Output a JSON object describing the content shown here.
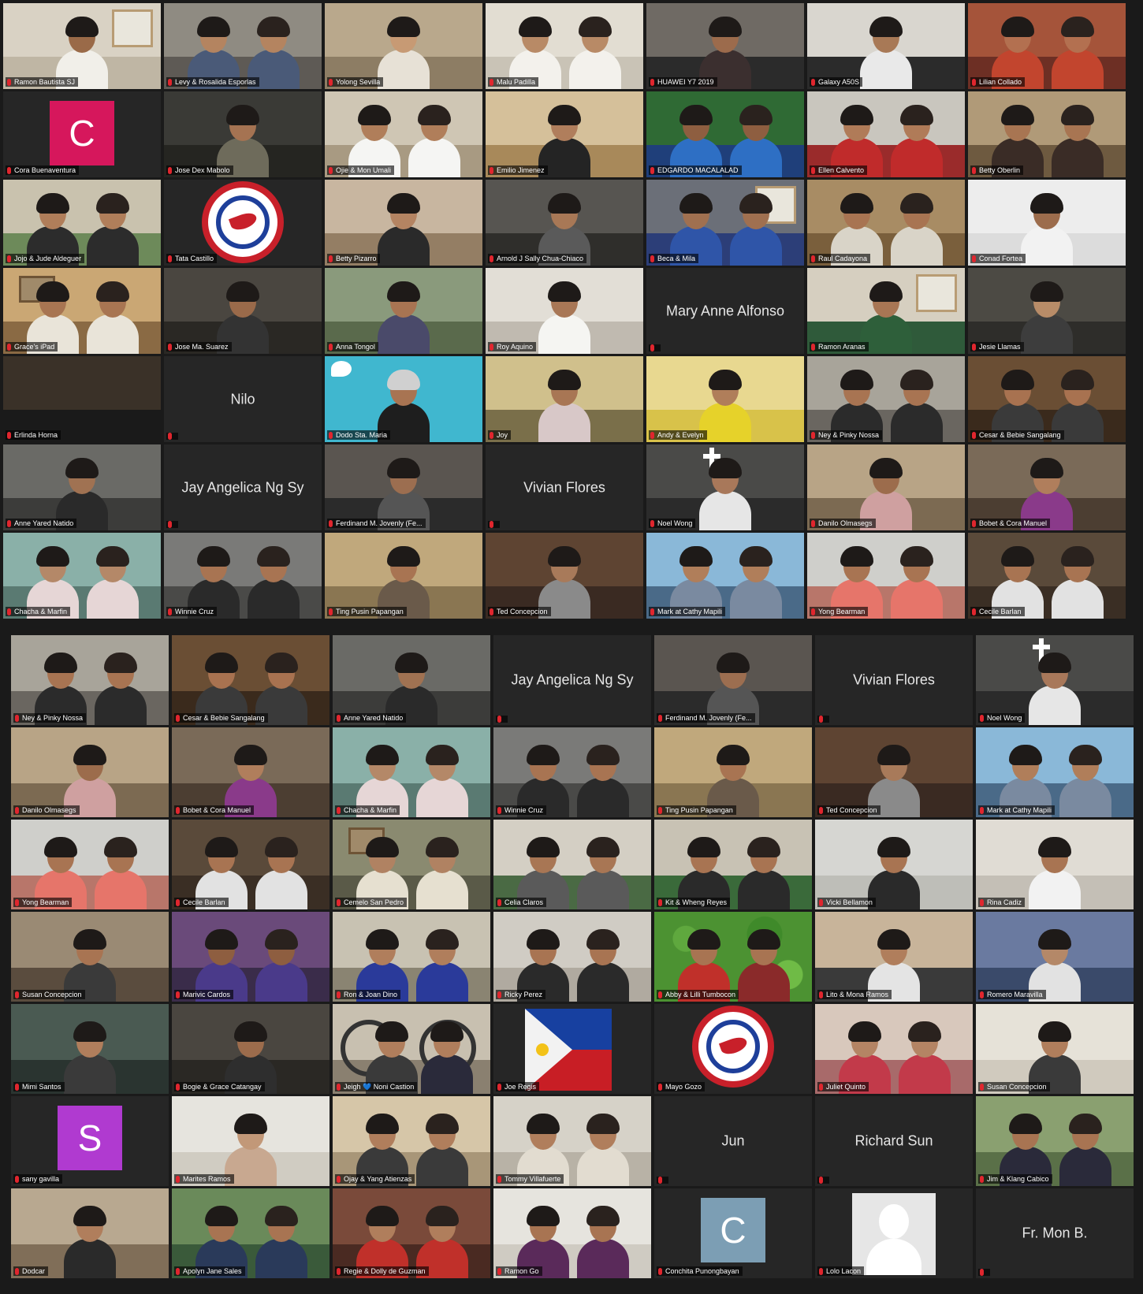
{
  "colors": {
    "background": "#1a1a1a",
    "tile": "#262626",
    "active_speaker_border": "#c8d36a",
    "muted_mic": "#e0262e",
    "avatar_pink": "#d6175c",
    "avatar_purple": "#b03ad0",
    "avatar_steel": "#7c9eb4"
  },
  "top_gallery": {
    "participants": [
      {
        "name": "Ramon Bautista SJ",
        "kind": "video",
        "people": 1,
        "wall": "#d9d2c4",
        "floor": "#bfb6a4",
        "skin": "#9a6a48",
        "shirt": "#f1efe9",
        "scene": "window"
      },
      {
        "name": "Levy & Rosalida Esporlas",
        "kind": "video",
        "people": 2,
        "wall": "#8f8b82",
        "floor": "#5e5a55",
        "skin": "#b48460",
        "shirt": "#4a5a78"
      },
      {
        "name": "Yolong Sevilla",
        "kind": "video",
        "people": 1,
        "wall": "#b9a88c",
        "floor": "#8d7d64",
        "skin": "#c79a74",
        "shirt": "#e7e1d6"
      },
      {
        "name": "Malu Padilla",
        "kind": "video",
        "people": 2,
        "wall": "#e2ddd2",
        "floor": "#c9c3b6",
        "skin": "#b88a66",
        "shirt": "#f3f1ec"
      },
      {
        "name": "HUAWEI Y7 2019",
        "kind": "video",
        "people": 1,
        "wall": "#6f6a64",
        "floor": "#2b2b2b",
        "skin": "#9c6b4c",
        "shirt": "#3b2f2f"
      },
      {
        "name": "Galaxy A50S",
        "kind": "video",
        "people": 1,
        "wall": "#d9d6cf",
        "floor": "#2b2b2b",
        "skin": "#a87956",
        "shirt": "#e9e9e9"
      },
      {
        "name": "Lilian Collado",
        "kind": "video",
        "people": 2,
        "wall": "#a5543a",
        "floor": "#6d2f24",
        "skin": "#b37050",
        "shirt": "#c2452e"
      },
      {
        "name": "Cora Buenaventura",
        "kind": "avatar",
        "letter": "C",
        "color": "#d6175c"
      },
      {
        "name": "Jose Dex Mabolo",
        "kind": "video",
        "people": 1,
        "wall": "#3a3a36",
        "floor": "#252521",
        "skin": "#a57352",
        "shirt": "#6e6b5b"
      },
      {
        "name": "Ojie & Mon Umali",
        "kind": "video",
        "people": 2,
        "wall": "#cfc6b4",
        "floor": "#a89a82",
        "skin": "#b07e5a",
        "shirt": "#f5f5f3"
      },
      {
        "name": "Emilio Jimenez",
        "kind": "video",
        "people": 1,
        "wall": "#d5c09a",
        "floor": "#a8895a",
        "skin": "#b07e5c",
        "shirt": "#242424"
      },
      {
        "name": "EDGARDO MACALALAD",
        "kind": "video",
        "people": 2,
        "wall": "#2f6a34",
        "floor": "#1f3f7a",
        "skin": "#8e5e40",
        "shirt": "#2e6fc4"
      },
      {
        "name": "Ellen Calvento",
        "kind": "video",
        "people": 2,
        "wall": "#c9c6be",
        "floor": "#9a2b2b",
        "skin": "#b07b58",
        "shirt": "#c02b2b"
      },
      {
        "name": "Betty Oberlin",
        "kind": "video",
        "people": 2,
        "wall": "#b09a78",
        "floor": "#6e5a40",
        "skin": "#a87552",
        "shirt": "#3a2c26"
      },
      {
        "name": "Jojo & Jude Aldeguer",
        "kind": "video",
        "people": 2,
        "wall": "#c9c2ae",
        "floor": "#6d8a5a",
        "skin": "#b07e5a",
        "shirt": "#2c2c2c"
      },
      {
        "name": "Tata Castillo",
        "kind": "logo"
      },
      {
        "name": "Betty Pizarro",
        "kind": "video",
        "people": 1,
        "wall": "#c8b6a0",
        "floor": "#947e64",
        "skin": "#b48462",
        "shirt": "#2a2a2a"
      },
      {
        "name": "Arnold J Sally Chua-Chiaco",
        "kind": "video",
        "people": 1,
        "wall": "#575551",
        "floor": "#2f2e2b",
        "skin": "#a87856",
        "shirt": "#5a5a5a"
      },
      {
        "name": "Beca & Mila",
        "kind": "video",
        "people": 2,
        "wall": "#6b6f78",
        "floor": "#2c3e78",
        "skin": "#a07050",
        "shirt": "#2f55a8",
        "scene": "window"
      },
      {
        "name": "Raul Cadayona",
        "kind": "video",
        "people": 2,
        "wall": "#a88c64",
        "floor": "#7a5f3c",
        "skin": "#a87452",
        "shirt": "#d9d4c8"
      },
      {
        "name": "Conad Fortea",
        "kind": "video",
        "people": 1,
        "wall": "#ededed",
        "floor": "#dcdcdc",
        "skin": "#9c6c4c",
        "shirt": "#f2f2f2"
      },
      {
        "name": "Grace's iPad",
        "kind": "video",
        "people": 2,
        "wall": "#caa774",
        "floor": "#8a6a44",
        "skin": "#a87552",
        "shirt": "#e9e4d9",
        "scene": "frame"
      },
      {
        "name": "Jose Ma. Suarez",
        "kind": "video",
        "people": 1,
        "wall": "#4a4640",
        "floor": "#2a2824",
        "skin": "#9a6a4a",
        "shirt": "#333"
      },
      {
        "name": "Anna Tongol",
        "kind": "video",
        "people": 1,
        "wall": "#8a9a7c",
        "floor": "#5a6a4c",
        "skin": "#a87452",
        "shirt": "#4a4a6a"
      },
      {
        "name": "Roy Aquino",
        "kind": "video",
        "people": 1,
        "wall": "#e2ded6",
        "floor": "#c0bab0",
        "skin": "#a87756",
        "shirt": "#f5f5f2"
      },
      {
        "name": "Mary Anne Alfonso",
        "kind": "name"
      },
      {
        "name": "Ramon Aranas",
        "kind": "video",
        "people": 1,
        "wall": "#d6cfc0",
        "floor": "#2f5a3a",
        "skin": "#a87654",
        "shirt": "#2e5f3a",
        "scene": "window"
      },
      {
        "name": "Jesie Llamas",
        "kind": "video",
        "people": 1,
        "wall": "#4c4a44",
        "floor": "#2e2d2a",
        "skin": "#b88c68",
        "shirt": "#3d3d3d"
      },
      {
        "name": "Erlinda Horna",
        "kind": "video",
        "people": 0,
        "wall": "#3a3128",
        "floor": "#1a1a1a"
      },
      {
        "name": "Nilo",
        "kind": "name"
      },
      {
        "name": "Dodo Sta. Maria",
        "kind": "twitter"
      },
      {
        "name": "Joy",
        "kind": "video",
        "people": 1,
        "wall": "#d0c08c",
        "floor": "#7a6f4a",
        "skin": "#a87654",
        "shirt": "#d8c8c8"
      },
      {
        "name": "Andy & Evelyn",
        "kind": "video",
        "people": 1,
        "wall": "#e8d890",
        "floor": "#d8c24a",
        "skin": "#b07e5a",
        "shirt": "#e6d22a"
      },
      {
        "name": "Ney & Pinky Nossa",
        "kind": "video",
        "people": 2,
        "wall": "#a8a49a",
        "floor": "#6a6660",
        "skin": "#a87452",
        "shirt": "#2b2b2b"
      },
      {
        "name": "Cesar & Bebie Sangalang",
        "kind": "video",
        "people": 2,
        "wall": "#6a4e34",
        "floor": "#3a2a1c",
        "skin": "#a87250",
        "shirt": "#3a3a3a"
      },
      {
        "name": "Anne Yared Natido",
        "kind": "video",
        "people": 1,
        "wall": "#6a6a66",
        "floor": "#3c3c3a",
        "skin": "#a07252",
        "shirt": "#2a2a2a"
      },
      {
        "name": "Jay Angelica Ng Sy",
        "kind": "name"
      },
      {
        "name": "Ferdinand M. Jovenly (Fe...",
        "kind": "video",
        "people": 1,
        "wall": "#5a5550",
        "floor": "#2b2b2b",
        "skin": "#9c6e50",
        "shirt": "#555"
      },
      {
        "name": "Vivian Flores",
        "kind": "name"
      },
      {
        "name": "Noel Wong",
        "kind": "video",
        "people": 1,
        "wall": "#4a4a48",
        "floor": "#2b2b2b",
        "skin": "#a8785a",
        "shirt": "#e6e6e6",
        "scene": "cross"
      },
      {
        "name": "Danilo Olmasegs",
        "kind": "video",
        "people": 1,
        "wall": "#b8a486",
        "floor": "#7c6a52",
        "skin": "#9c6c4c",
        "shirt": "#cfa0a0"
      },
      {
        "name": "Bobet & Cora Manuel",
        "kind": "video",
        "people": 1,
        "wall": "#7a6a58",
        "floor": "#4c3e32",
        "skin": "#b07e5c",
        "shirt": "#8a3a8a"
      },
      {
        "name": "Chacha & Marfin",
        "kind": "video",
        "people": 2,
        "wall": "#8ab0a8",
        "floor": "#5a7a72",
        "skin": "#b48868",
        "shirt": "#e6d6d6"
      },
      {
        "name": "Winnie Cruz",
        "kind": "video",
        "people": 2,
        "wall": "#7a7a78",
        "floor": "#4a4a48",
        "skin": "#a87452",
        "shirt": "#2a2a2a"
      },
      {
        "name": "Ting Pusin Papangan",
        "kind": "video",
        "people": 1,
        "wall": "#c0a87c",
        "floor": "#8a7652",
        "skin": "#a87452",
        "shirt": "#6a5a4a"
      },
      {
        "name": "Ted Concepcion",
        "kind": "video",
        "people": 1,
        "wall": "#5e4432",
        "floor": "#3a2a22",
        "skin": "#a87a5a",
        "shirt": "#8a8a8a"
      },
      {
        "name": "Mark at Cathy Mapili",
        "kind": "video",
        "people": 2,
        "wall": "#8ab8d8",
        "floor": "#4a6a88",
        "skin": "#b07e5a",
        "shirt": "#7a8aa0"
      },
      {
        "name": "Yong Bearman",
        "kind": "video",
        "people": 2,
        "wall": "#cfcfcb",
        "floor": "#b8766a",
        "skin": "#a87452",
        "shirt": "#e6756a",
        "active": true
      },
      {
        "name": "Cecile Barlan",
        "kind": "video",
        "people": 2,
        "wall": "#5a4a3a",
        "floor": "#3a2e24",
        "skin": "#a87452",
        "shirt": "#e2e2e2"
      }
    ]
  },
  "bottom_gallery": {
    "participants": [
      {
        "name": "Ney & Pinky Nossa",
        "kind": "video",
        "people": 2,
        "wall": "#a8a49a",
        "floor": "#6a6660",
        "skin": "#a87452",
        "shirt": "#2b2b2b"
      },
      {
        "name": "Cesar & Bebie Sangalang",
        "kind": "video",
        "people": 2,
        "wall": "#6a4e34",
        "floor": "#3a2a1c",
        "skin": "#a87250",
        "shirt": "#3a3a3a"
      },
      {
        "name": "Anne Yared Natido",
        "kind": "video",
        "people": 1,
        "wall": "#6a6a66",
        "floor": "#3c3c3a",
        "skin": "#a07252",
        "shirt": "#2a2a2a"
      },
      {
        "name": "Jay Angelica Ng Sy",
        "kind": "name"
      },
      {
        "name": "Ferdinand M. Jovenly (Fe...",
        "kind": "video",
        "people": 1,
        "wall": "#5a5550",
        "floor": "#2b2b2b",
        "skin": "#9c6e50",
        "shirt": "#555"
      },
      {
        "name": "Vivian Flores",
        "kind": "name"
      },
      {
        "name": "Noel Wong",
        "kind": "video",
        "people": 1,
        "wall": "#4a4a48",
        "floor": "#2b2b2b",
        "skin": "#a8785a",
        "shirt": "#e6e6e6",
        "scene": "cross"
      },
      {
        "name": "Danilo Olmasegs",
        "kind": "video",
        "people": 1,
        "wall": "#b8a486",
        "floor": "#7c6a52",
        "skin": "#9c6c4c",
        "shirt": "#cfa0a0"
      },
      {
        "name": "Bobet & Cora Manuel",
        "kind": "video",
        "people": 1,
        "wall": "#7a6a58",
        "floor": "#4c3e32",
        "skin": "#b07e5c",
        "shirt": "#8a3a8a"
      },
      {
        "name": "Chacha & Marfin",
        "kind": "video",
        "people": 2,
        "wall": "#8ab0a8",
        "floor": "#5a7a72",
        "skin": "#b48868",
        "shirt": "#e6d6d6"
      },
      {
        "name": "Winnie Cruz",
        "kind": "video",
        "people": 2,
        "wall": "#7a7a78",
        "floor": "#4a4a48",
        "skin": "#a87452",
        "shirt": "#2a2a2a"
      },
      {
        "name": "Ting Pusin Papangan",
        "kind": "video",
        "people": 1,
        "wall": "#c0a87c",
        "floor": "#8a7652",
        "skin": "#a87452",
        "shirt": "#6a5a4a"
      },
      {
        "name": "Ted Concepcion",
        "kind": "video",
        "people": 1,
        "wall": "#5e4432",
        "floor": "#3a2a22",
        "skin": "#a87a5a",
        "shirt": "#8a8a8a"
      },
      {
        "name": "Mark at Cathy Mapili",
        "kind": "video",
        "people": 2,
        "wall": "#8ab8d8",
        "floor": "#4a6a88",
        "skin": "#b07e5a",
        "shirt": "#7a8aa0"
      },
      {
        "name": "Yong Bearman",
        "kind": "video",
        "people": 2,
        "wall": "#cfcfcb",
        "floor": "#b8766a",
        "skin": "#a87452",
        "shirt": "#e6756a",
        "active": true
      },
      {
        "name": "Cecile Barlan",
        "kind": "video",
        "people": 2,
        "wall": "#5a4a3a",
        "floor": "#3a2e24",
        "skin": "#a87452",
        "shirt": "#e2e2e2"
      },
      {
        "name": "Cemelo San Pedro",
        "kind": "video",
        "people": 2,
        "wall": "#8a8a70",
        "floor": "#5a5a48",
        "skin": "#b08262",
        "shirt": "#e6e0d0",
        "scene": "frame"
      },
      {
        "name": "Celia Claros",
        "kind": "video",
        "people": 2,
        "wall": "#d4cfc4",
        "floor": "#4a6a44",
        "skin": "#a87654",
        "shirt": "#5a5a5a"
      },
      {
        "name": "Kit & Wheng Reyes",
        "kind": "video",
        "people": 2,
        "wall": "#c8c2b4",
        "floor": "#3a6a3a",
        "skin": "#a87452",
        "shirt": "#2a2a2a"
      },
      {
        "name": "Vicki Bellamon",
        "kind": "video",
        "people": 1,
        "wall": "#d6d6d2",
        "floor": "#bebeb8",
        "skin": "#a87452",
        "shirt": "#2a2a2a"
      },
      {
        "name": "Rina Cadiz",
        "kind": "video",
        "people": 1,
        "wall": "#e0dcd4",
        "floor": "#c4bfb6",
        "skin": "#a87452",
        "shirt": "#f2f2f2"
      },
      {
        "name": "Susan Concepcion",
        "kind": "video",
        "people": 1,
        "wall": "#9a8a74",
        "floor": "#5a4c3e",
        "skin": "#a87452",
        "shirt": "#3a3a3a"
      },
      {
        "name": "Marivic Cardos",
        "kind": "video",
        "people": 2,
        "wall": "#6a4a7a",
        "floor": "#3a2c4a",
        "skin": "#8e5e40",
        "shirt": "#4a3a8a"
      },
      {
        "name": "Ron & Joan Dino",
        "kind": "video",
        "people": 2,
        "wall": "#c8c2b2",
        "floor": "#8a8472",
        "skin": "#b07e5c",
        "shirt": "#2a3a9a"
      },
      {
        "name": "Ricky Perez",
        "kind": "video",
        "people": 2,
        "wall": "#d0ccc4",
        "floor": "#b0aaa0",
        "skin": "#a87452",
        "shirt": "#2a2a2a"
      },
      {
        "name": "Abby & Lilli Tumbocon",
        "kind": "leaves"
      },
      {
        "name": "Lito & Mona Ramos",
        "kind": "video",
        "people": 1,
        "wall": "#c8b49a",
        "floor": "#3a3a3a",
        "skin": "#b07e5c",
        "shirt": "#e4e4e4"
      },
      {
        "name": "Romero Maravilla",
        "kind": "video",
        "people": 1,
        "wall": "#6a7aa0",
        "floor": "#3a4a6a",
        "skin": "#b48868",
        "shirt": "#e2e2e2"
      },
      {
        "name": "Mimi Santos",
        "kind": "video",
        "people": 1,
        "wall": "#4a5a52",
        "floor": "#2a3430",
        "skin": "#b07e5c",
        "shirt": "#3a3a3a"
      },
      {
        "name": "Bogie & Grace Catangay",
        "kind": "video",
        "people": 1,
        "wall": "#4a4640",
        "floor": "#2a2824",
        "skin": "#9c6c4c",
        "shirt": "#2e2e2e"
      },
      {
        "name": "Jeigh 💙 Noni Castion",
        "kind": "bike"
      },
      {
        "name": "Joe Regis",
        "kind": "flag"
      },
      {
        "name": "Mayo Gozo",
        "kind": "logo"
      },
      {
        "name": "Juliet Quinto",
        "kind": "video",
        "people": 2,
        "wall": "#d8c8bc",
        "floor": "#a86a6a",
        "skin": "#b48464",
        "shirt": "#c23a4a"
      },
      {
        "name": "Susan Concepcion",
        "kind": "video",
        "people": 1,
        "wall": "#e6e2d8",
        "floor": "#d0cabe",
        "skin": "#b07e5c",
        "shirt": "#3a3a3a"
      },
      {
        "name": "sany gavilla",
        "kind": "avatar",
        "letter": "S",
        "color": "#b03ad0"
      },
      {
        "name": "Marites Ramos",
        "kind": "video",
        "people": 1,
        "wall": "#e6e4de",
        "floor": "#d0ccc2",
        "skin": "#c29878",
        "shirt": "#c8a890"
      },
      {
        "name": "Ojay & Yang Atienzas",
        "kind": "video",
        "people": 2,
        "wall": "#d6c6a8",
        "floor": "#a89678",
        "skin": "#b07e5c",
        "shirt": "#3a3a3a"
      },
      {
        "name": "Tommy Villafuerte",
        "kind": "video",
        "people": 2,
        "wall": "#d6d2c8",
        "floor": "#b8b2a6",
        "skin": "#b07e5c",
        "shirt": "#e2dcd0"
      },
      {
        "name": "Jun",
        "kind": "name"
      },
      {
        "name": "Richard Sun",
        "kind": "name"
      },
      {
        "name": "Jim & Klang Cabico",
        "kind": "video",
        "people": 2,
        "wall": "#8aa070",
        "floor": "#5a7048",
        "skin": "#a87452",
        "shirt": "#2a2a3a"
      },
      {
        "name": "Dodcar",
        "kind": "video",
        "people": 1,
        "wall": "#b8a890",
        "floor": "#806e58",
        "skin": "#b07e5c",
        "shirt": "#2a2a2a"
      },
      {
        "name": "Apolyn Jane Sales",
        "kind": "video",
        "people": 2,
        "wall": "#6a8a5a",
        "floor": "#3a5a3a",
        "skin": "#a87452",
        "shirt": "#2a3a5a"
      },
      {
        "name": "Regie & Dolly de Guzman",
        "kind": "video",
        "people": 2,
        "wall": "#7a4a3a",
        "floor": "#4a2a22",
        "skin": "#b07e5c",
        "shirt": "#c0302a"
      },
      {
        "name": "Ramon Go",
        "kind": "video",
        "people": 2,
        "wall": "#e6e4de",
        "floor": "#cfcbc2",
        "skin": "#a87452",
        "shirt": "#5a2a5a"
      },
      {
        "name": "Conchita Punongbayan",
        "kind": "avatar",
        "letter": "C",
        "color": "#7c9eb4"
      },
      {
        "name": "Lolo Lacon",
        "kind": "blank"
      },
      {
        "name": "Fr. Mon B.",
        "kind": "name"
      }
    ]
  }
}
